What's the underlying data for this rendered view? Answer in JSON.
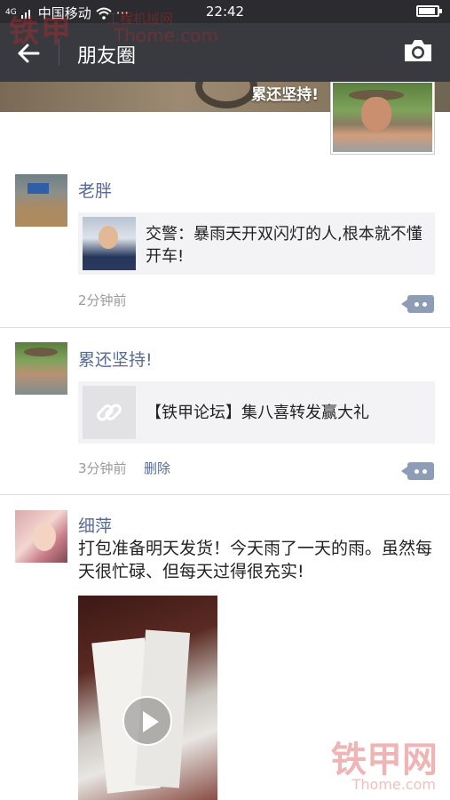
{
  "status_bar": {
    "carrier": "中国移动",
    "signal_badge": "4G",
    "extra": "···",
    "time": "22:42"
  },
  "watermarks": {
    "top_logo": "铁甲",
    "top_sub": "工程机械网",
    "top_url": "Thome.com",
    "bottom_logo": "铁甲网",
    "bottom_url": "Thome.com"
  },
  "nav": {
    "title": "朋友圈",
    "back_icon": "arrow-left-icon",
    "camera_icon": "camera-icon"
  },
  "cover": {
    "owner_name": "累还坚持!"
  },
  "posts": [
    {
      "username": "老胖",
      "card_text": "交警：暴雨天开双闪灯的人,根本就不懂开车!",
      "time": "2分钟前"
    },
    {
      "username": "累还坚持!",
      "card_text": "【铁甲论坛】集八喜转发赢大礼",
      "card_icon": "link-icon",
      "time": "3分钟前",
      "delete_label": "删除"
    },
    {
      "username": "细萍",
      "text": "打包准备明天发货！今天雨了一天的雨。虽然每天很忙碌、但每天过得很充实!",
      "media_icon": "play-icon"
    }
  ],
  "colors": {
    "nav_bg": "#393a3f",
    "username": "#576b95",
    "time": "#9b9b9b"
  }
}
